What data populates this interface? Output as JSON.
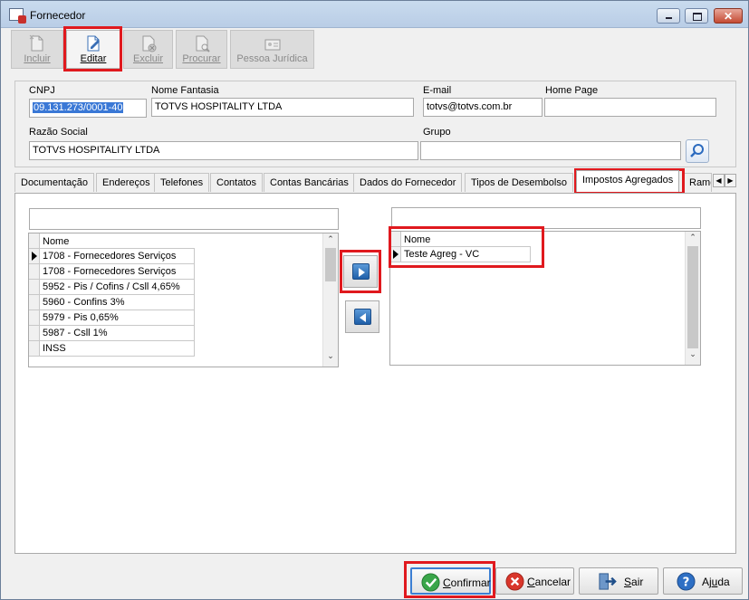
{
  "window": {
    "title": "Fornecedor"
  },
  "toolbar": {
    "buttons": [
      {
        "label": "Incluir",
        "mnemonic": "I",
        "enabled": false
      },
      {
        "label": "Editar",
        "mnemonic": "E",
        "enabled": true
      },
      {
        "label": "Excluir",
        "mnemonic": "x",
        "enabled": false
      },
      {
        "label": "Procurar",
        "mnemonic": "P",
        "enabled": false
      },
      {
        "label": "Pessoa Jurídica",
        "enabled": false
      }
    ]
  },
  "form": {
    "cnpj": {
      "label": "CNPJ",
      "value": "09.131.273/0001-40"
    },
    "nome_fantasia": {
      "label": "Nome Fantasia",
      "value": "TOTVS HOSPITALITY LTDA"
    },
    "email": {
      "label": "E-mail",
      "value": "totvs@totvs.com.br"
    },
    "home_page": {
      "label": "Home Page",
      "value": ""
    },
    "razao_social": {
      "label": "Razão Social",
      "value": "TOTVS HOSPITALITY LTDA"
    },
    "grupo": {
      "label": "Grupo",
      "value": ""
    }
  },
  "tabs": [
    "Documentação",
    "Endereços",
    "Telefones",
    "Contatos",
    "Contas Bancárias",
    "Dados do Fornecedor",
    "Tipos de Desembolso",
    "Impostos Agregados",
    "Ramo"
  ],
  "active_tab": "Impostos Agregados",
  "available_grid": {
    "header": "Nome",
    "rows": [
      "1708 - Fornecedores Serviços",
      "1708 - Fornecedores Serviços",
      "5952 - Pis / Cofins / Csll 4,65%",
      "5960 - Confins 3%",
      "5979 - Pis 0,65%",
      "5987 - Csll 1%",
      "INSS"
    ]
  },
  "selected_grid": {
    "header": "Nome",
    "rows": [
      "Teste Agreg - VC"
    ]
  },
  "footer": {
    "confirmar": {
      "pre": "",
      "mn": "C",
      "post": "onfirmar"
    },
    "cancelar": {
      "pre": "",
      "mn": "C",
      "post": "ancelar"
    },
    "sair": {
      "pre": "",
      "mn": "S",
      "post": "air"
    },
    "ajuda": {
      "pre": "Aj",
      "mn": "u",
      "post": "da"
    }
  },
  "colors": {
    "highlight": "#e0191e",
    "selection": "#3a78d6",
    "accent_blue": "#1f5fa8"
  }
}
